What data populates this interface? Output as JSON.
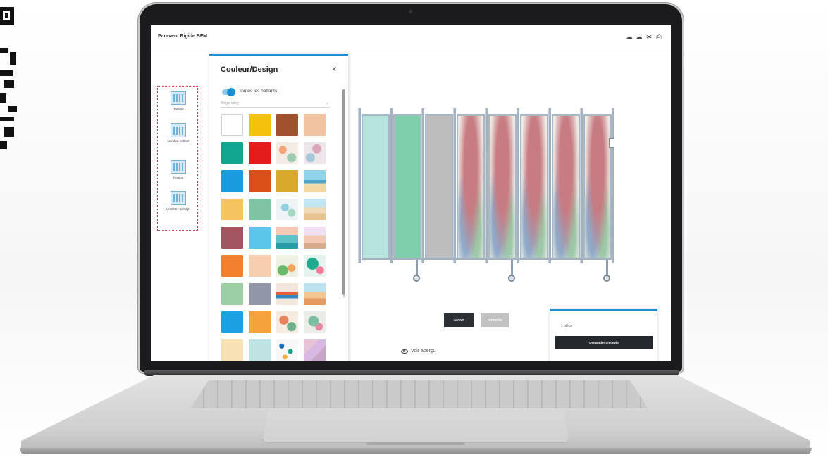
{
  "app": {
    "title": "Paravent Rigide BFM",
    "header_icons": [
      "cloud-icon",
      "cloud-upload-icon",
      "mail-icon",
      "print-icon"
    ]
  },
  "steps": [
    {
      "label": "Hauteur",
      "icon": "partition-height-icon"
    },
    {
      "label": "Nombre battant",
      "icon": "partition-count-icon"
    },
    {
      "label": "Finition",
      "icon": "partition-finish-icon"
    },
    {
      "label": "Couleur - Design",
      "icon": "partition-color-icon"
    }
  ],
  "panel": {
    "title": "Couleur/Design",
    "close_icon": "close-icon",
    "toggle_label": "Toutes les battants",
    "toggle_on": true,
    "select_value": "Single wing",
    "accent": "#1c8fd1",
    "swatches": [
      "#ffffff",
      "#f4c20d",
      "#a0522d",
      "#f1c3a0",
      "#12a58f",
      "#e51c1c",
      "pattern-floral-a",
      "pattern-floral-b",
      "#1a9be0",
      "#d94f17",
      "#d8a92c",
      "pattern-beach",
      "#f5c45e",
      "#7fc3a4",
      "pattern-tropical-a",
      "pattern-shore",
      "#a35660",
      "#5cc6ea",
      "pattern-sea",
      "pattern-sand",
      "#f3802e",
      "#f6ceb0",
      "pattern-plants",
      "pattern-leaves",
      "#99cfa3",
      "#9197a9",
      "pattern-tropical-b",
      "pattern-dunes",
      "#1aa1e3",
      "#f4a23b",
      "pattern-floral-c",
      "pattern-floral-d",
      "#f7e1b5",
      "#bfe3e3",
      "pattern-confetti",
      "pattern-pastel"
    ]
  },
  "preview": {
    "panel_fills": [
      "#b7e3df",
      "#7fcfaa",
      "#bdbdbd",
      "pattern-palm",
      "pattern-palm",
      "pattern-palm",
      "pattern-palm",
      "pattern-palm"
    ]
  },
  "controls": {
    "primary_label": "AVANT",
    "secondary_label": "ARRIÈRE",
    "preview_link": "Voir aperçu"
  },
  "quote": {
    "quantity": "1 pièce",
    "button": "Demander un devis"
  }
}
